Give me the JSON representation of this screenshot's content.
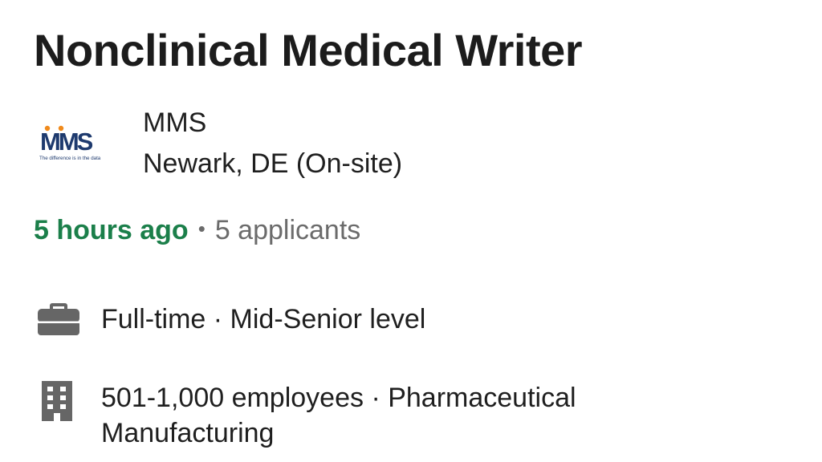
{
  "job": {
    "title": "Nonclinical Medical Writer"
  },
  "company": {
    "name": "MMS",
    "location": "Newark, DE (On-site)",
    "logo_text": "MMS",
    "logo_tagline": "The difference is in the data"
  },
  "meta": {
    "posted": "5 hours ago",
    "separator": "•",
    "applicants": "5 applicants"
  },
  "details": {
    "job_type": {
      "icon": "briefcase-icon",
      "text": "Full-time · Mid-Senior level"
    },
    "company_size": {
      "icon": "building-icon",
      "text": "501-1,000 employees · Pharmaceutical Manufacturing"
    }
  },
  "colors": {
    "posted_green": "#1b7f4a",
    "muted_gray": "#6b6b6b",
    "icon_gray": "#666666",
    "logo_navy": "#1e3a6e",
    "logo_orange": "#f08a1c"
  }
}
